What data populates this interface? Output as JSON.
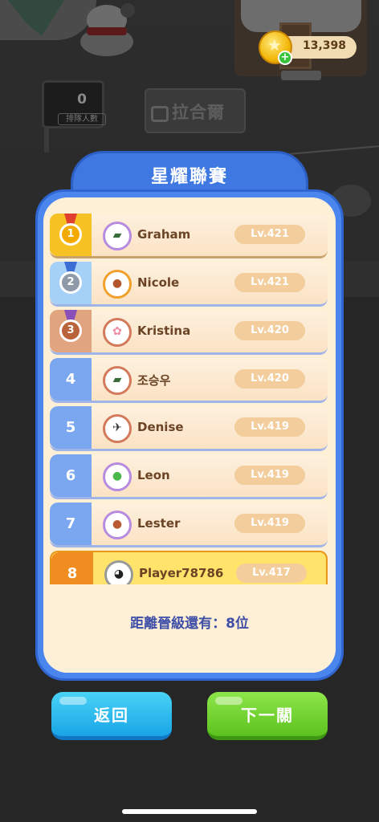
{
  "background": {
    "queue_count": "0",
    "queue_label": "排隊人數",
    "bus_stop_name": "拉合爾"
  },
  "currency": {
    "coins": "13,398",
    "icon": "star-coin-icon",
    "add_icon": "plus-icon"
  },
  "league": {
    "title": "星耀聯賽",
    "rows": [
      {
        "rank": "1",
        "name": "Graham",
        "level": "Lv.421",
        "badge": "gold-medal"
      },
      {
        "rank": "2",
        "name": "Nicole",
        "level": "Lv.421",
        "badge": "silver-medal"
      },
      {
        "rank": "3",
        "name": "Kristina",
        "level": "Lv.420",
        "badge": "bronze-medal"
      },
      {
        "rank": "4",
        "name": "조승우",
        "level": "Lv.420",
        "badge": "none"
      },
      {
        "rank": "5",
        "name": "Denise",
        "level": "Lv.419",
        "badge": "none"
      },
      {
        "rank": "6",
        "name": "Leon",
        "level": "Lv.419",
        "badge": "none"
      },
      {
        "rank": "7",
        "name": "Lester",
        "level": "Lv.419",
        "badge": "none"
      },
      {
        "rank": "8",
        "name": "Player78786",
        "level": "Lv.417",
        "badge": "current-player"
      }
    ],
    "promotion_text": "距離晉級還有：8位"
  },
  "buttons": {
    "back": "返回",
    "next": "下一關"
  },
  "colors": {
    "panel_blue": "#4a86ee",
    "panel_cream": "#fdf0d6",
    "gold": "#f6c122",
    "silver": "#a6d1f7",
    "bronze": "#e0a47e",
    "rank_blue": "#7aa7ef",
    "player_highlight": "#ffe36a",
    "back_button": "#19a5e6",
    "next_button": "#5cc21f"
  }
}
